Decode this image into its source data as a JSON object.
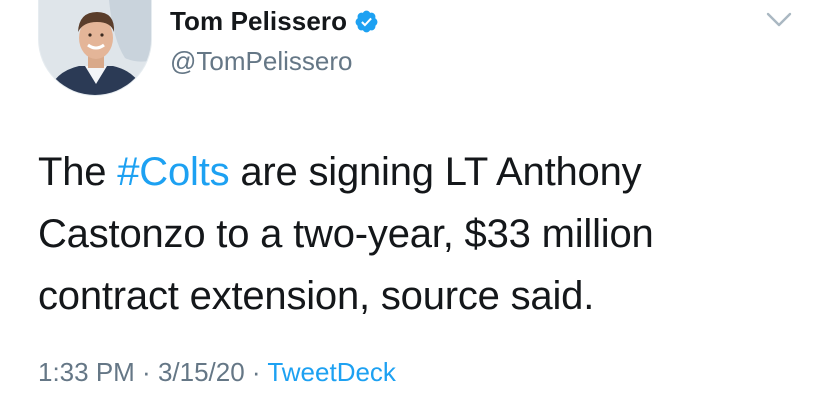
{
  "author": {
    "display_name": "Tom Pelissero",
    "handle": "@TomPelissero",
    "verified": true
  },
  "tweet": {
    "text_before": "The ",
    "hashtag": "#Colts",
    "text_after": " are signing LT Anthony Castonzo to a two-year, $33 million contract extension, source said."
  },
  "meta": {
    "time": "1:33 PM",
    "separator_1": " · ",
    "date": "3/15/20",
    "separator_2": " · ",
    "source": "TweetDeck"
  },
  "icons": {
    "verified": "verified-badge-icon",
    "menu": "chevron-down-icon"
  },
  "colors": {
    "link": "#1da1f2",
    "secondary_text": "#657786",
    "primary_text": "#14171a",
    "caret": "#aab8c2"
  }
}
